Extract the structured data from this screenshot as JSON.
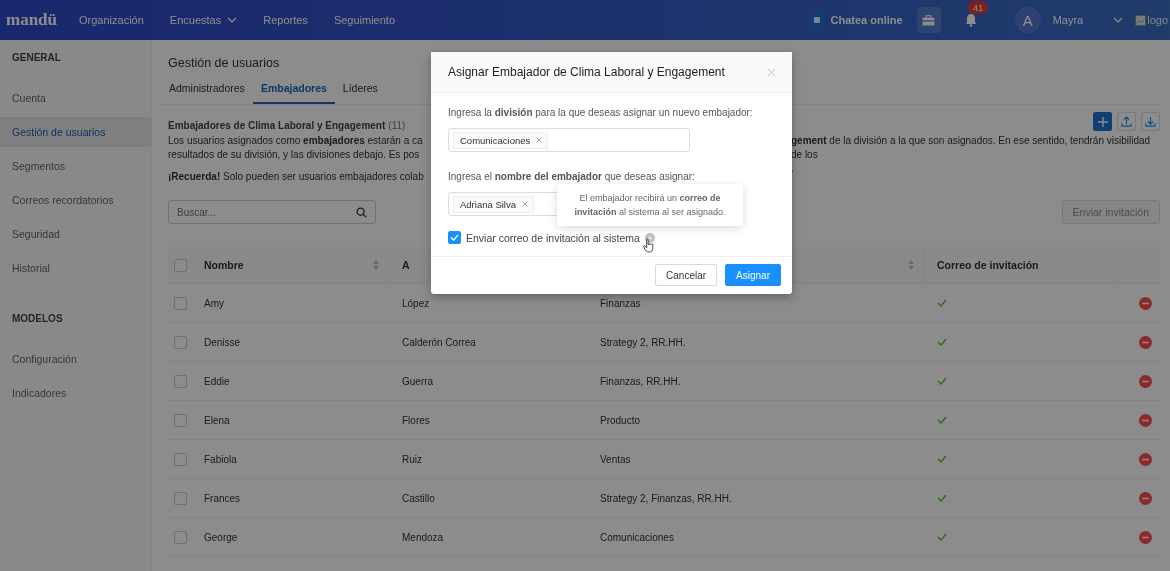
{
  "topbar": {
    "logo": "mandü",
    "nav": [
      {
        "label": "Organización",
        "dropdown": false
      },
      {
        "label": "Encuestas",
        "dropdown": true
      },
      {
        "label": "Reportes",
        "dropdown": false
      },
      {
        "label": "Seguimiento",
        "dropdown": false
      }
    ],
    "chat": "Chatea online",
    "notifications": "41",
    "avatar_initial": "A",
    "user": "Mayra",
    "logo_alt": "logo"
  },
  "sidebar": {
    "sections": [
      {
        "heading": "GENERAL",
        "items": [
          {
            "label": "Cuenta",
            "selected": false
          },
          {
            "label": "Gestión de usuarios",
            "selected": true
          },
          {
            "label": "Segmentos",
            "selected": false
          },
          {
            "label": "Correos recordatorios",
            "selected": false
          },
          {
            "label": "Seguridad",
            "selected": false
          },
          {
            "label": "Historial",
            "selected": false
          }
        ]
      },
      {
        "heading": "MODELOS",
        "items": [
          {
            "label": "Configuración",
            "selected": false
          },
          {
            "label": "Indicadores",
            "selected": false
          }
        ]
      }
    ]
  },
  "page": {
    "title": "Gestión de usuarios",
    "tabs": [
      {
        "label": "Administradores",
        "selected": false
      },
      {
        "label": "Embajadores",
        "selected": true
      },
      {
        "label": "Líderes",
        "selected": false
      }
    ],
    "section_title": "Embajadores de Clima Laboral y Engagement",
    "count": "(11)",
    "description_left": [
      "Los usuarios asignados como **embajadores** estarán a ca",
      "resultados de su división, y las divisiones debajo. Es pos",
      "**¡Recuerda!** Solo pueden ser usuarios embajadores colab"
    ],
    "description_right": [
      "**gement** de la división a la que son asignados. En ese sentido, tendrán visibilidad de los",
      "."
    ],
    "search": {
      "placeholder": "Buscar..."
    },
    "send_button": {
      "label": "Enviar invitación",
      "disabled": true
    }
  },
  "table": {
    "header_checked": false,
    "columns": [
      {
        "label": "Nombre",
        "sortable": true
      },
      {
        "label": "A"
      },
      {
        "sortable": true
      },
      {
        "label": "Correo de invitación"
      }
    ],
    "rows": [
      {
        "checked": false,
        "name": "Amy",
        "surname": "López",
        "divisions": "Finanzas",
        "invited": true
      },
      {
        "checked": false,
        "name": "Denisse",
        "surname": "Calderón Correa",
        "divisions": "Strategy 2, RR.HH.",
        "invited": true
      },
      {
        "checked": false,
        "name": "Eddie",
        "surname": "Guerra",
        "divisions": "Finanzas, RR.HH.",
        "invited": true
      },
      {
        "checked": false,
        "name": "Elena",
        "surname": "Flores",
        "divisions": "Producto",
        "invited": true
      },
      {
        "checked": false,
        "name": "Fabiola",
        "surname": "Ruiz",
        "divisions": "Ventas",
        "invited": true
      },
      {
        "checked": false,
        "name": "Frances",
        "surname": "Castillo",
        "divisions": "Strategy 2, Finanzas, RR.HH.",
        "invited": true
      },
      {
        "checked": false,
        "name": "George",
        "surname": "Mendoza",
        "divisions": "Comunicaciones",
        "invited": true
      }
    ]
  },
  "modal": {
    "title": "Asignar Embajador de Clima Laboral y Engagement",
    "division_label": "Ingresa la **división** para la que deseas asignar un nuevo embajador:",
    "division_tags": [
      "Comunicaciones"
    ],
    "ambassador_label": "Ingresa el **nombre del embajador** que deseas asignar:",
    "ambassador_tags": [
      "Adriana Silva"
    ],
    "send_invite": {
      "label": "Enviar correo de invitación al sistema",
      "checked": true
    },
    "tooltip": "El embajador recibirá un **correo de invitación** al sistema al ser asignado.",
    "buttons": [
      {
        "label": "Cancelar",
        "kind": "default"
      },
      {
        "label": "Asignar",
        "kind": "primary"
      }
    ]
  }
}
